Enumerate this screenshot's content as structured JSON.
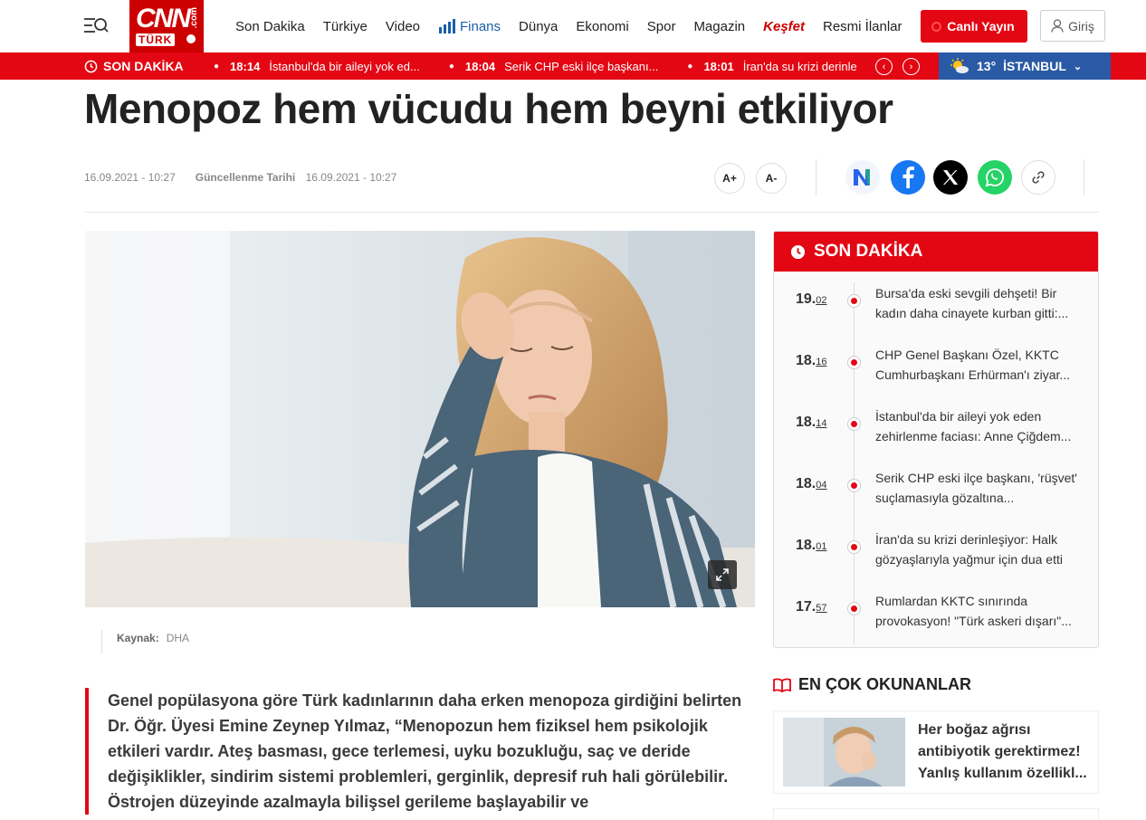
{
  "header": {
    "logo_main": "CNN",
    "logo_sub": "TÜRK",
    "logo_com": ".com",
    "nav": [
      "Son Dakika",
      "Türkiye",
      "Video",
      "Finans",
      "Dünya",
      "Ekonomi",
      "Spor",
      "Magazin",
      "Keşfet",
      "Resmi İlanlar"
    ],
    "live_label": "Canlı Yayın",
    "login_label": "Giriş"
  },
  "breaking_bar": {
    "label": "SON DAKİKA",
    "items": [
      {
        "time": "18:14",
        "text": "İstanbul'da bir aileyi yok ed..."
      },
      {
        "time": "18:04",
        "text": "Serik CHP eski ilçe başkanı..."
      },
      {
        "time": "18:01",
        "text": "İran'da su krizi derinleş"
      }
    ],
    "weather": {
      "temp": "13°",
      "city": "İSTANBUL"
    }
  },
  "article": {
    "title": "Menopoz hem vücudu hem beyni etkiliyor",
    "published": "16.09.2021 - 10:27",
    "updated_label": "Güncellenme Tarihi",
    "updated": "16.09.2021 - 10:27",
    "font_plus": "A+",
    "font_minus": "A-",
    "source_label": "Kaynak:",
    "source": "DHA",
    "lead": "Genel popülasyona göre Türk kadınlarının daha erken menopoza girdiğini belirten Dr. Öğr. Üyesi Emine Zeynep Yılmaz, “Menopozun hem fiziksel hem psikolojik etkileri vardır. Ateş basması, gece terlemesi, uyku bozukluğu, saç ve deride değişiklikler, sindirim sistemi problemleri, gerginlik, depresif ruh hali görülebilir. Östrojen düzeyinde azalmayla bilişsel gerileme başlayabilir ve"
  },
  "sidebar": {
    "son_dakika_title": "SON DAKİKA",
    "items": [
      {
        "hour": "19.",
        "min": "02",
        "text": "Bursa'da eski sevgili dehşeti! Bir kadın daha cinayete kurban gitti:..."
      },
      {
        "hour": "18.",
        "min": "16",
        "text": "CHP Genel Başkanı Özel, KKTC Cumhurbaşkanı Erhürman'ı ziyar..."
      },
      {
        "hour": "18.",
        "min": "14",
        "text": "İstanbul'da bir aileyi yok eden zehirlenme faciası: Anne Çiğdem..."
      },
      {
        "hour": "18.",
        "min": "04",
        "text": "Serik CHP eski ilçe başkanı, 'rüşvet' suçlamasıyla gözaltına..."
      },
      {
        "hour": "18.",
        "min": "01",
        "text": "İran'da su krizi derinleşiyor: Halk gözyaşlarıyla yağmur için dua etti"
      },
      {
        "hour": "17.",
        "min": "57",
        "text": "Rumlardan KKTC sınırında provokasyon! \"Türk askeri dışarı\"..."
      }
    ],
    "most_read_title": "EN ÇOK OKUNANLAR",
    "most_read": [
      {
        "text": "Her boğaz ağrısı antibiyotik gerektirmez! Yanlış kullanım özellikl..."
      }
    ]
  },
  "colors": {
    "brand_red": "#e30613",
    "finans_blue": "#1a5fa8",
    "weather_blue": "#2a5aa5"
  }
}
